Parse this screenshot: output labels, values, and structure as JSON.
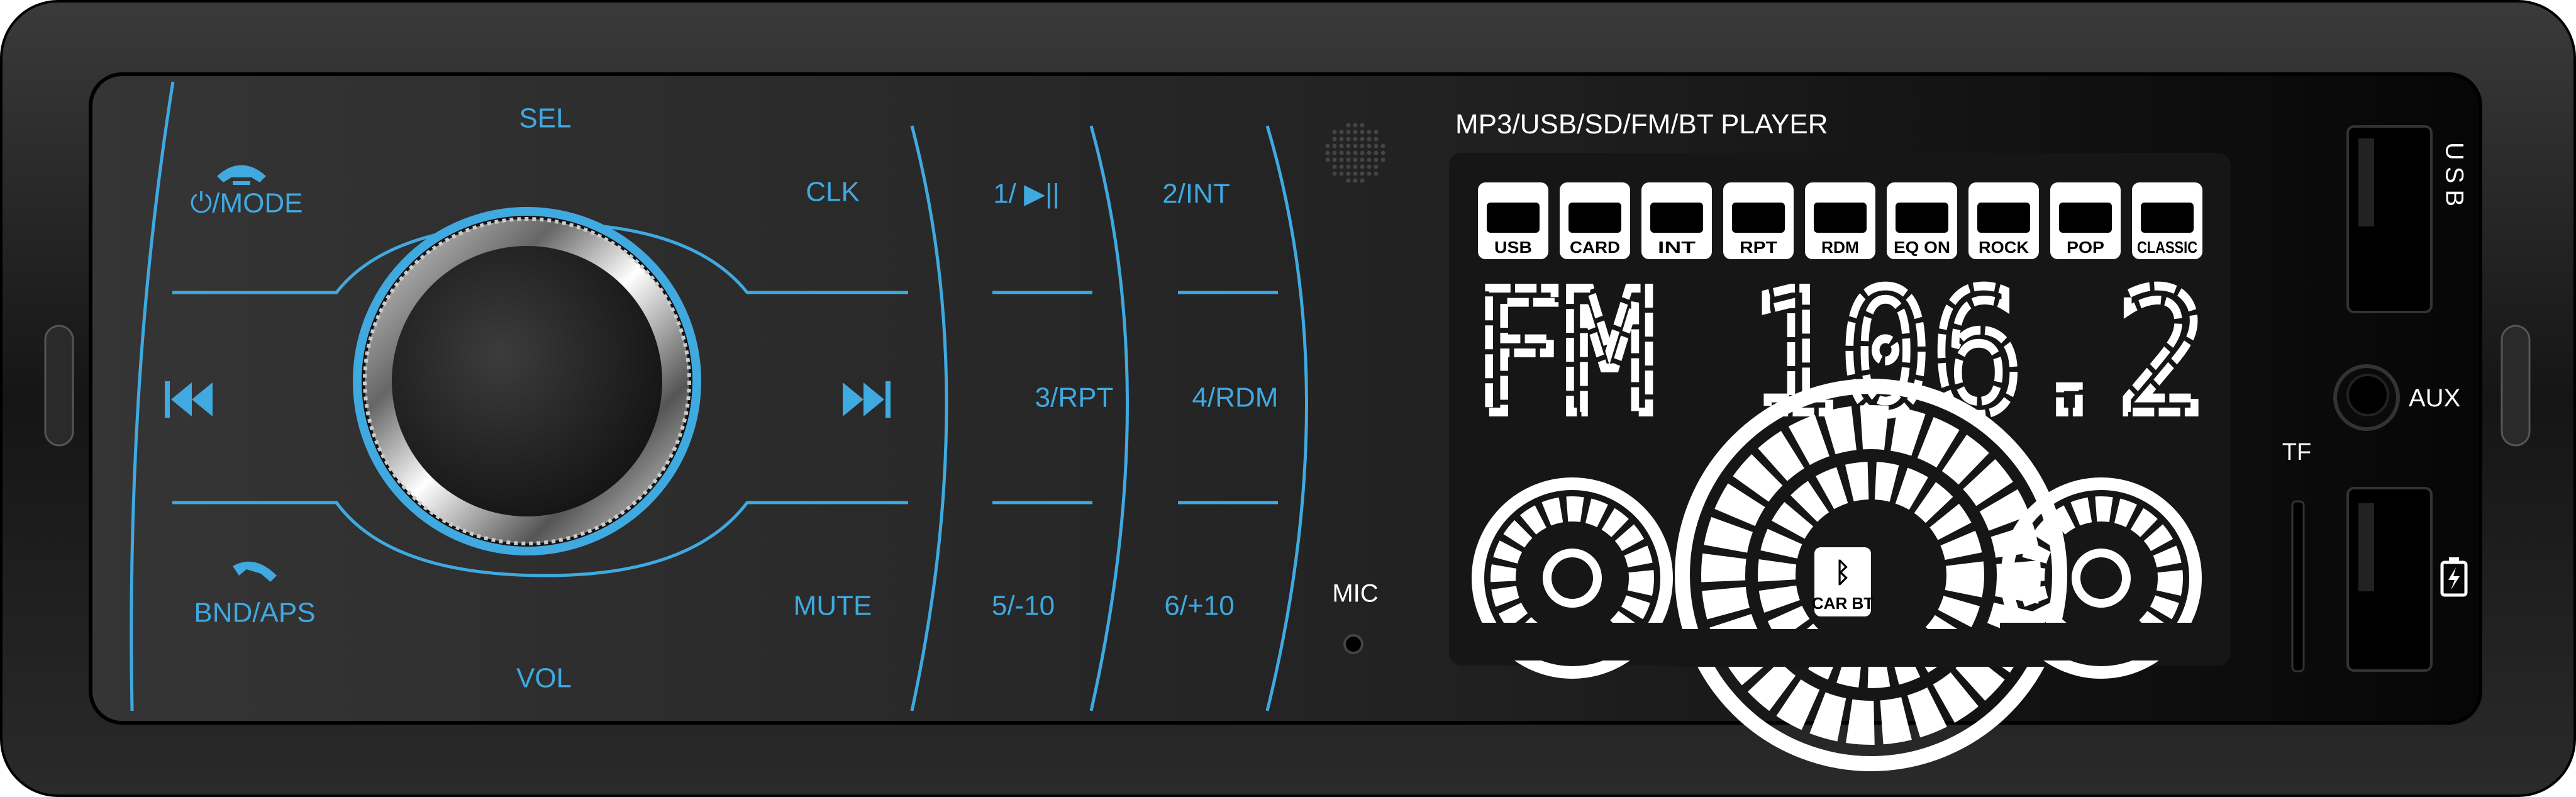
{
  "device": {
    "colors": {
      "accent": "#3fa9e0",
      "body": "#1c1c1c",
      "panel": "#2f2f2f",
      "lcd": "#141414",
      "segment": "#ffffff"
    },
    "left_panel": {
      "sel": "SEL",
      "mode": "⏻/MODE",
      "clk": "CLK",
      "prev_icon": "skip-previous-icon",
      "next_icon": "skip-next-icon",
      "bnd": "BND/APS",
      "mute": "MUTE",
      "vol": "VOL"
    },
    "presets": [
      {
        "label": "1/ ▶||"
      },
      {
        "label": "2/INT"
      },
      {
        "label": "3/RPT"
      },
      {
        "label": "4/RDM"
      },
      {
        "label": "5/-10"
      },
      {
        "label": "6/+10"
      }
    ],
    "mic": "MIC",
    "title": "MP3/USB/SD/FM/BT PLAYER",
    "lcd": {
      "indicators": [
        {
          "label": "USB",
          "icon": "usb-stick-icon"
        },
        {
          "label": "CARD",
          "icon": "sd-card-icon"
        },
        {
          "label": "INT",
          "icon": "intro-arrow-icon"
        },
        {
          "label": "RPT",
          "icon": "repeat-icon"
        },
        {
          "label": "RDM",
          "icon": "random-icon"
        },
        {
          "label": "EQ ON",
          "icon": "eq-wave-icon"
        },
        {
          "label": "ROCK",
          "icon": "music-note-icon"
        },
        {
          "label": "POP",
          "icon": "headphones-icon"
        },
        {
          "label": "CLASSIC",
          "icon": "saxophone-icon"
        }
      ],
      "main_text": "FM 106.2",
      "bt_label": "CAR BT"
    },
    "ports": {
      "usb": "USB",
      "aux": "AUX",
      "tf": "TF",
      "charge_icon": "battery-charging-icon"
    }
  }
}
